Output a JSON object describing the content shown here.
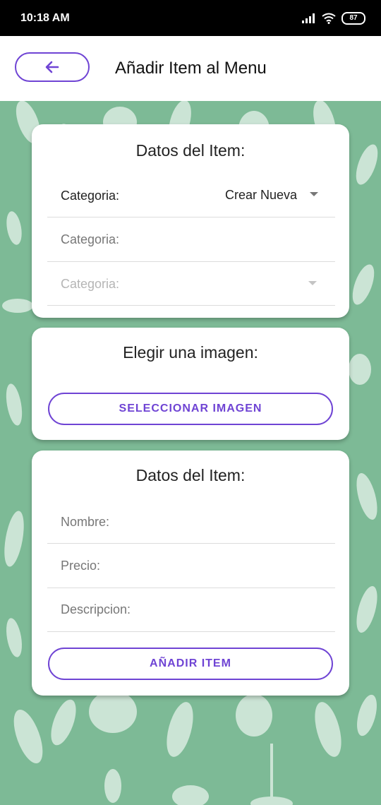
{
  "status": {
    "time": "10:18 AM",
    "battery": "87"
  },
  "header": {
    "title": "Añadir Item al Menu",
    "back_icon": "arrow-left-icon"
  },
  "category_card": {
    "title": "Datos del Item:",
    "category_label": "Categoria:",
    "category_dropdown_value": "Crear Nueva",
    "new_category_placeholder": "Categoria:",
    "category_select_placeholder": "Categoria:"
  },
  "image_card": {
    "title": "Elegir una imagen:",
    "select_button_label": "SELECCIONAR IMAGEN"
  },
  "item_card": {
    "title": "Datos del Item:",
    "name_placeholder": "Nombre:",
    "price_placeholder": "Precio:",
    "description_placeholder": "Descripcion:",
    "add_button_label": "AÑADIR ITEM"
  },
  "colors": {
    "accent": "#6f44d4",
    "background": "#7dba96"
  }
}
